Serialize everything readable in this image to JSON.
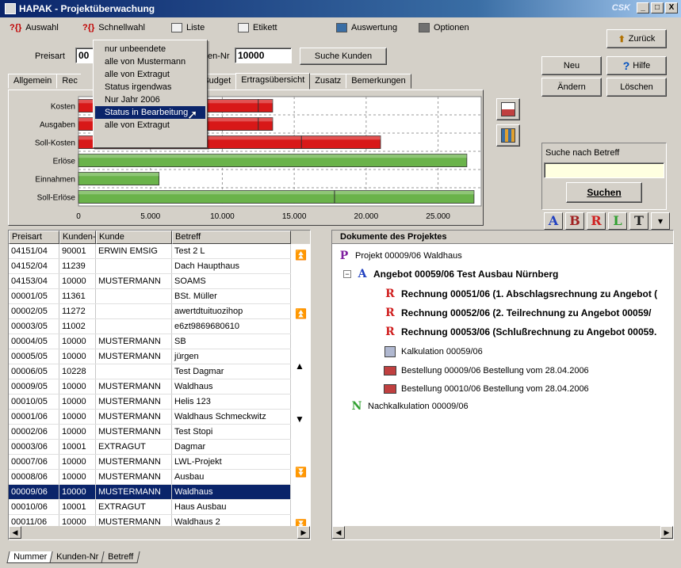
{
  "window": {
    "title": "HAPAK - Projektüberwachung",
    "brand": "CSK",
    "min": "_",
    "max": "□",
    "close": "X"
  },
  "menu": {
    "auswahl": "Auswahl",
    "schnellwahl": "Schnellwahl",
    "liste": "Liste",
    "etikett": "Etikett",
    "auswertung": "Auswertung",
    "optionen": "Optionen",
    "help_mark": "?{}"
  },
  "toolbar": {
    "preisart_label": "Preisart",
    "preisart_value": "00",
    "kunden_label": "en-Nr",
    "kunden_value": "10000",
    "suche_kunden": "Suche Kunden",
    "zurueck": "Zurück",
    "neu": "Neu",
    "hilfe": "Hilfe",
    "aendern": "Ändern",
    "loeschen": "Löschen"
  },
  "tabs": [
    "Allgemein",
    "Rec",
    "Budget",
    "Ertragsübersicht",
    "Zusatz",
    "Bemerkungen"
  ],
  "dropdown": {
    "items": [
      "nur unbeendete",
      "alle von Mustermann",
      "alle von Extragut",
      "Status irgendwas",
      "Nur Jahr 2006",
      "Status in Bearbeitung",
      "alle von Extragut"
    ],
    "selected_index": 5
  },
  "chart_data": {
    "type": "bar",
    "categories": [
      "Kosten",
      "Ausgaben",
      "Soll-Kosten",
      "Erlöse",
      "Einnahmen",
      "Soll-Erlöse"
    ],
    "series": [
      {
        "values": [
          13500,
          13500,
          21000,
          0,
          0,
          0
        ],
        "color": "#d81818"
      },
      {
        "values": [
          0,
          0,
          0,
          27000,
          5600,
          27500
        ],
        "color": "#6ab34a"
      }
    ],
    "segments": [
      {
        "category": "Kosten",
        "split": 12500
      },
      {
        "category": "Ausgaben",
        "split": 12500
      },
      {
        "category": "Soll-Kosten",
        "split": 15500
      },
      {
        "category": "Soll-Erlöse",
        "split": 17800
      }
    ],
    "xticks": [
      "0",
      "5.000",
      "10.000",
      "15.000",
      "20.000",
      "25.000"
    ],
    "xlim": [
      0,
      28000
    ],
    "grid": true
  },
  "search": {
    "label": "Suche nach Betreff",
    "value": "",
    "button": "Suchen"
  },
  "format_buttons": [
    "A",
    "B",
    "R",
    "L",
    "T",
    "▾"
  ],
  "grid": {
    "headers": [
      "Preisart",
      "Kunden-Nr",
      "Kunde",
      "Betreff"
    ],
    "rows": [
      [
        "04151/04",
        "90001",
        "ERWIN EMSIG",
        "Test 2 L"
      ],
      [
        "04152/04",
        "11239",
        "",
        "Dach Haupthaus"
      ],
      [
        "04153/04",
        "10000",
        "MUSTERMANN",
        "SOAMS"
      ],
      [
        "00001/05",
        "11361",
        "",
        "BSt. Müller"
      ],
      [
        "00002/05",
        "11272",
        "",
        "awertdtuituozihop"
      ],
      [
        "00003/05",
        "11002",
        "",
        "e6zt9869680610"
      ],
      [
        "00004/05",
        "10000",
        "MUSTERMANN",
        "SB"
      ],
      [
        "00005/05",
        "10000",
        "MUSTERMANN",
        "jürgen"
      ],
      [
        "00006/05",
        "10228",
        "",
        "Test Dagmar"
      ],
      [
        "00009/05",
        "10000",
        "MUSTERMANN",
        "Waldhaus"
      ],
      [
        "00010/05",
        "10000",
        "MUSTERMANN",
        "Helis 123"
      ],
      [
        "00001/06",
        "10000",
        "MUSTERMANN",
        "Waldhaus Schmeckwitz"
      ],
      [
        "00002/06",
        "10000",
        "MUSTERMANN",
        "Test Stopi"
      ],
      [
        "00003/06",
        "10001",
        "EXTRAGUT",
        "Dagmar"
      ],
      [
        "00007/06",
        "10000",
        "MUSTERMANN",
        "LWL-Projekt"
      ],
      [
        "00008/06",
        "10000",
        "MUSTERMANN",
        "Ausbau"
      ],
      [
        "00009/06",
        "10000",
        "MUSTERMANN",
        "Waldhaus"
      ],
      [
        "00010/06",
        "10001",
        "EXTRAGUT",
        "Haus Ausbau"
      ],
      [
        "00011/06",
        "10000",
        "MUSTERMANN",
        "Waldhaus 2"
      ]
    ],
    "selected_index": 16
  },
  "bottom_tabs": [
    "Nummer",
    "Kunden-Nr",
    "Betreff"
  ],
  "docs": {
    "header": "Dokumente des Projektes",
    "project": "Projekt 00009/06 Waldhaus",
    "angebot": "Angebot 00059/06 Test Ausbau Nürnberg",
    "rechnung1": "Rechnung 00051/06 (1. Abschlagsrechnung zu Angebot (",
    "rechnung2": "Rechnung 00052/06 (2. Teilrechnung zu Angebot 00059/",
    "rechnung3": "Rechnung 00053/06 (Schlußrechnung zu Angebot 00059.",
    "kalkulation": "Kalkulation 00059/06",
    "bestellung1": "Bestellung 00009/06 Bestellung vom 28.04.2006",
    "bestellung2": "Bestellung 00010/06 Bestellung vom 28.04.2006",
    "nachkalkulation": "Nachkalkulation 00009/06",
    "minus": "−"
  }
}
